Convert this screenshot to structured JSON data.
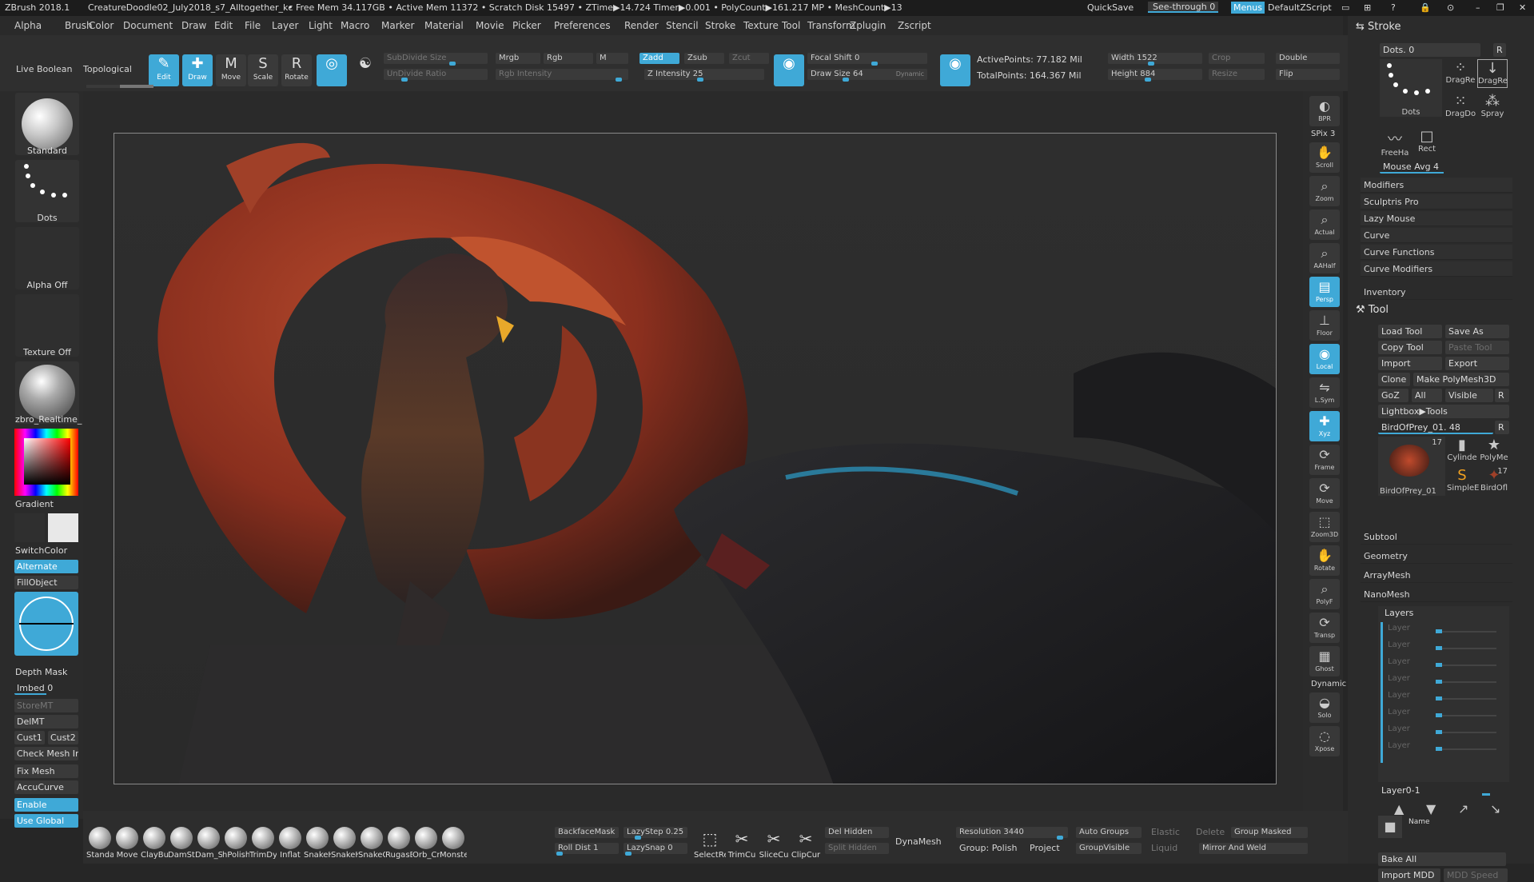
{
  "titlebar": {
    "app": "ZBrush 2018.1",
    "document": "CreatureDoodle02_July2018_s7_Alltogether_kc",
    "stats": "• Free Mem 34.117GB • Active Mem 11372 • Scratch Disk 15497 • ZTime▶14.724 Timer▶0.001 • PolyCount▶161.217 MP • MeshCount▶13",
    "quicksave": "QuickSave",
    "seethrough": "See-through  0",
    "menus": "Menus",
    "defaultzscript": "DefaultZScript"
  },
  "menubar": [
    "Alpha",
    "Brush",
    "Color",
    "Document",
    "Draw",
    "Edit",
    "File",
    "Layer",
    "Light",
    "Macro",
    "Marker",
    "Material",
    "Movie",
    "Picker",
    "Preferences",
    "Render",
    "Stencil",
    "Stroke",
    "Texture",
    "Tool",
    "Transform",
    "Zplugin",
    "Zscript"
  ],
  "topshelf": {
    "live_boolean": "Live Boolean",
    "topological": "Topological",
    "tools": [
      "Edit",
      "Draw",
      "Move",
      "Scale",
      "Rotate"
    ],
    "subdivide_size": "SubDivide Size",
    "undivide_ratio": "UnDivide Ratio",
    "mrgb": "Mrgb",
    "rgb": "Rgb",
    "m": "M",
    "rgb_intensity": "Rgb Intensity",
    "zadd": "Zadd",
    "zsub": "Zsub",
    "zcut": "Zcut",
    "z_intensity": "Z Intensity 25",
    "focal_shift": "Focal Shift 0",
    "draw_size": "Draw Size 64",
    "dynamic": "Dynamic",
    "active_points": "ActivePoints: 77.182 Mil",
    "total_points": "TotalPoints: 164.367 Mil",
    "width": "Width 1522",
    "height": "Height 884",
    "crop": "Crop",
    "resize": "Resize",
    "double": "Double",
    "flip": "Flip"
  },
  "leftshelf": {
    "brush": "Standard",
    "stroke": "Dots",
    "alpha": "Alpha Off",
    "texture": "Texture Off",
    "material": "zbro_Realtime_",
    "gradient": "Gradient",
    "switchcolor": "SwitchColor",
    "alternate": "Alternate",
    "fillobject": "FillObject",
    "depth_mask": "Depth Mask",
    "imbed": "Imbed 0",
    "storemt": "StoreMT",
    "delmt": "DelMT",
    "cust1": "Cust1",
    "cust2": "Cust2",
    "check_mesh": "Check Mesh In",
    "fix_mesh": "Fix Mesh",
    "accucurve": "AccuCurve",
    "enable": "Enable",
    "use_global": "Use Global"
  },
  "rightshelf": [
    "BPR",
    "SPix 3",
    "Scroll",
    "Zoom",
    "Actual",
    "AAHalf",
    "Persp",
    "Floor",
    "Local",
    "L.Sym",
    "Xyz",
    "Frame",
    "Move",
    "Zoom3D",
    "Rotate",
    "PolyF",
    "Transp",
    "Ghost",
    "Dynamic",
    "Solo",
    "Xpose"
  ],
  "tray": {
    "stroke_title": "Stroke",
    "dots_count": "Dots. 0",
    "r": "R",
    "stroke_items": [
      "Dots",
      "DragRe",
      "Dots",
      "DragDo",
      "Spray",
      "FreeHa",
      "Rect"
    ],
    "mouse_avg": "Mouse Avg 4",
    "stroke_sections": [
      "Modifiers",
      "Sculptris Pro",
      "Lazy Mouse",
      "Curve",
      "Curve Functions",
      "Curve Modifiers"
    ],
    "inventory": "Inventory",
    "tool_title": "Tool",
    "load_tool": "Load Tool",
    "save_as": "Save As",
    "copy_tool": "Copy Tool",
    "paste_tool": "Paste Tool",
    "import": "Import",
    "export": "Export",
    "clone": "Clone",
    "make_polymesh": "Make PolyMesh3D",
    "goz": "GoZ",
    "all": "All",
    "visible": "Visible",
    "lightbox": "Lightbox▶Tools",
    "current_tool": "BirdOfPrey_01. 48",
    "tool_thumbs": [
      "BirdOfPrey_01",
      "Cylinde",
      "PolyMe",
      "SimpleE",
      "BirdOfl"
    ],
    "badge_17a": "17",
    "badge_17b": "17",
    "tool_sections": [
      "Subtool",
      "Geometry",
      "ArrayMesh",
      "NanoMesh"
    ],
    "layers_title": "Layers",
    "layers": [
      "Layer",
      "Layer",
      "Layer",
      "Layer",
      "Layer",
      "Layer",
      "Layer",
      "Layer"
    ],
    "layer0": "Layer0-1",
    "name": "Name",
    "bake_all": "Bake All",
    "import_mdd": "Import MDD",
    "mdd_speed": "MDD Speed"
  },
  "bottomshelf": {
    "brushes": [
      "Standa",
      "Move",
      "ClayBui",
      "DamSta",
      "Dam_St",
      "hPolish",
      "TrimDy",
      "Inflat",
      "SnakeH",
      "SnakeH",
      "SnakeC",
      "RugasB",
      "Orb_Cr",
      "Monste"
    ],
    "backfacemask": "BackfaceMask",
    "roll_dist": "Roll Dist 1",
    "lazystep": "LazyStep 0.25",
    "lazysnap": "LazySnap 0",
    "select_tools": [
      "SelectRe",
      "TrimCu",
      "SliceCu",
      "ClipCur"
    ],
    "del_hidden": "Del Hidden",
    "split_hidden": "Split Hidden",
    "dynamesh": "DynaMesh",
    "resolution": "Resolution 3440",
    "group_polish": "Group: Polish",
    "project": "Project",
    "auto_groups": "Auto Groups",
    "groupvisible": "GroupVisible",
    "elastic": "Elastic",
    "liquid": "Liquid",
    "delete": "Delete",
    "group_masked": "Group Masked",
    "mirror_weld": "Mirror And Weld"
  },
  "colors": {
    "accent": "#3fa9d7",
    "panel": "#2b2b2b",
    "wing": "#9e3a24"
  }
}
